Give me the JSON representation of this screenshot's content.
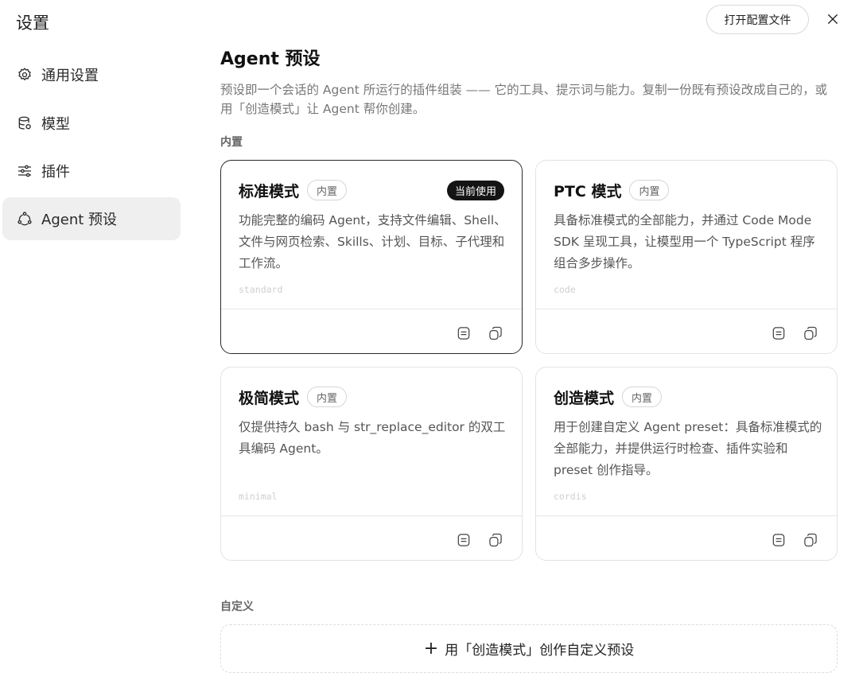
{
  "sidebar": {
    "title": "设置",
    "items": [
      {
        "label": "通用设置",
        "icon": "gear-icon"
      },
      {
        "label": "模型",
        "icon": "database-icon"
      },
      {
        "label": "插件",
        "icon": "sliders-icon"
      },
      {
        "label": "Agent 预设",
        "icon": "agent-cycle-icon",
        "active": true
      }
    ]
  },
  "header": {
    "open_config_label": "打开配置文件",
    "close_icon": "close-icon"
  },
  "main": {
    "title": "Agent 预设",
    "description": "预设即一个会话的 Agent 所运行的插件组装 —— 它的工具、提示词与能力。复制一份既有预设改成自己的，或用「创造模式」让 Agent 帮你创建。",
    "builtin_label": "内置",
    "custom_label": "自定义",
    "create_label": "用「创造模式」创作自定义预设",
    "create_icon": "plus-icon",
    "cards": [
      {
        "name": "标准模式",
        "tag": "内置",
        "current": "当前使用",
        "description": "功能完整的编码 Agent，支持文件编辑、Shell、文件与网页检索、Skills、计划、目标、子代理和工作流。",
        "id": "standard"
      },
      {
        "name": "PTC 模式",
        "tag": "内置",
        "description": "具备标准模式的全部能力，并通过 Code Mode SDK 呈现工具，让模型用一个 TypeScript 程序组合多步操作。",
        "id": "code"
      },
      {
        "name": "极简模式",
        "tag": "内置",
        "description": "仅提供持久 bash 与 str_replace_editor 的双工具编码 Agent。",
        "id": "minimal"
      },
      {
        "name": "创造模式",
        "tag": "内置",
        "description": "用于创建自定义 Agent preset：具备标准模式的全部能力，并提供运行时检查、插件实验和 preset 创作指导。",
        "id": "cordis"
      }
    ]
  }
}
